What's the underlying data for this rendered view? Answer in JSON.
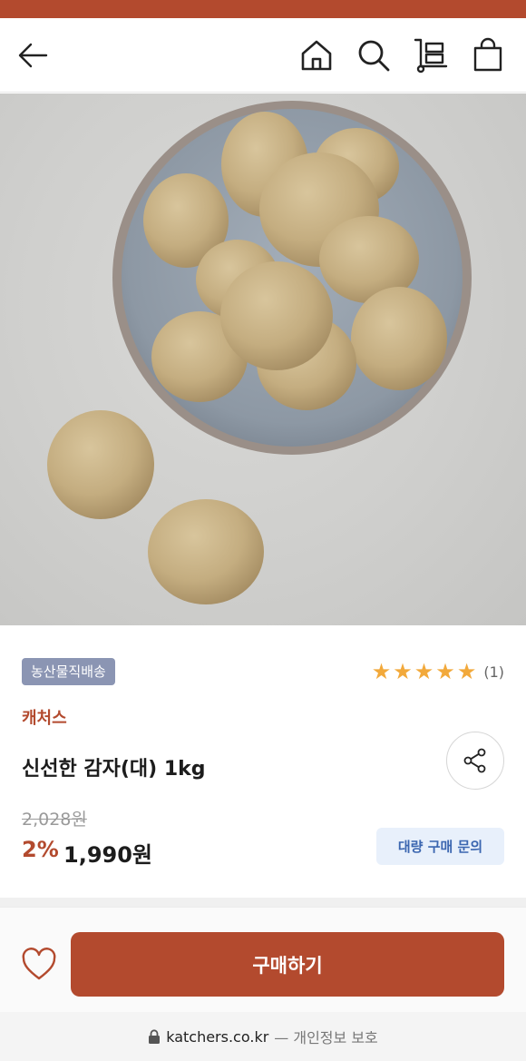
{
  "header": {
    "back_icon": "back-arrow-icon",
    "home_icon": "home-icon",
    "search_icon": "search-icon",
    "cart_icon": "cart-icon",
    "bag_icon": "shopping-bag-icon",
    "brand_color": "#b34a2e"
  },
  "product": {
    "badge": "농산물직배송",
    "rating_stars": 5,
    "rating_count": "(1)",
    "brand": "캐처스",
    "title": "신선한 감자(대) 1kg",
    "original_price": "2,028원",
    "discount": "2%",
    "price": "1,990원",
    "bulk_inquiry": "대량 구매 문의",
    "share_icon": "share-icon"
  },
  "bottom": {
    "wishlist_icon": "heart-icon",
    "buy_label": "구매하기"
  },
  "browser": {
    "lock_icon": "lock-icon",
    "domain": "katchers.co.kr",
    "suffix": "— 개인정보 보호"
  }
}
